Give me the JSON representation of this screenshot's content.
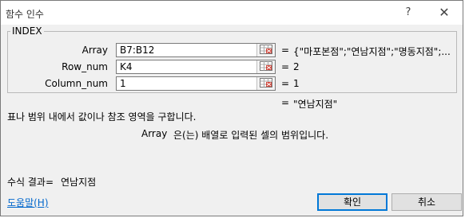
{
  "window": {
    "title": "함수 인수",
    "help_label": "?",
    "close_label": "✕"
  },
  "function_name": "INDEX",
  "args": [
    {
      "label": "Array",
      "value": "B7:B12",
      "result": "{\"마포본점\";\"연남지점\";\"명동지점\";..."
    },
    {
      "label": "Row_num",
      "value": "K4",
      "result": "2"
    },
    {
      "label": "Column_num",
      "value": "1",
      "result": "1"
    }
  ],
  "eq_sign": "=",
  "function_result": "\"연남지점\"",
  "function_description": "표나 범위 내에서 값이나 참조 영역을 구합니다.",
  "arg_description": {
    "name": "Array",
    "text": "은(는) 배열로 입력된 셀의 범위입니다."
  },
  "formula_result": {
    "label": "수식 결과=",
    "value": "연남지점"
  },
  "help_link": "도움말(H)",
  "buttons": {
    "ok": "확인",
    "cancel": "취소"
  }
}
